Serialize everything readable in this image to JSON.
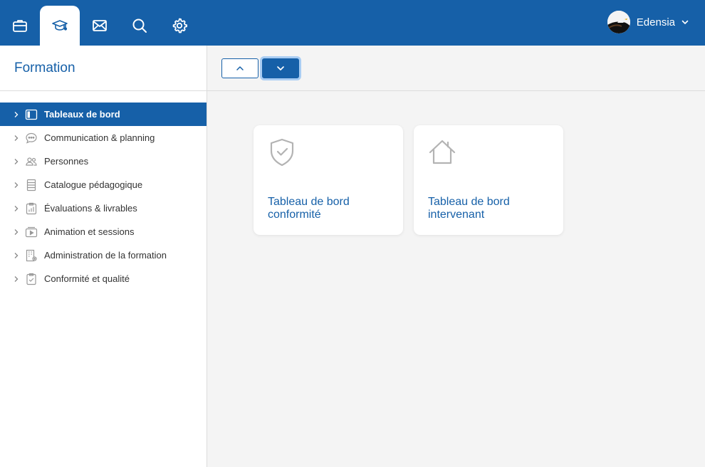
{
  "header": {
    "tabs": [
      {
        "icon": "briefcase-icon",
        "active": false
      },
      {
        "icon": "graduation-cap-icon",
        "active": true
      },
      {
        "icon": "mail-icon",
        "active": false
      },
      {
        "icon": "search-icon",
        "active": false
      },
      {
        "icon": "gear-icon",
        "active": false
      }
    ],
    "user": {
      "name": "Edensia",
      "avatar_icon": "eagle-avatar",
      "menu_icon": "chevron-down-icon"
    },
    "background_color": "#1660a8"
  },
  "sidebar": {
    "title": "Formation",
    "items": [
      {
        "label": "Tableaux de bord",
        "icon": "dashboard-icon",
        "active": true
      },
      {
        "label": "Communication & planning",
        "icon": "chat-bubble-icon",
        "active": false
      },
      {
        "label": "Personnes",
        "icon": "people-icon",
        "active": false
      },
      {
        "label": "Catalogue pédagogique",
        "icon": "list-icon",
        "active": false
      },
      {
        "label": "Évaluations & livrables",
        "icon": "chart-document-icon",
        "active": false
      },
      {
        "label": "Animation et sessions",
        "icon": "video-play-icon",
        "active": false
      },
      {
        "label": "Administration de la formation",
        "icon": "building-gear-icon",
        "active": false
      },
      {
        "label": "Conformité et qualité",
        "icon": "clipboard-check-icon",
        "active": false
      }
    ]
  },
  "toolbar": {
    "buttons": [
      {
        "icon": "chevron-up-icon",
        "style": "outline"
      },
      {
        "icon": "chevron-down-icon",
        "style": "filled-focused"
      }
    ]
  },
  "cards": [
    {
      "label": "Tableau de bord conformité",
      "icon": "shield-check-icon"
    },
    {
      "label": "Tableau de bord intervenant",
      "icon": "house-icon"
    }
  ],
  "colors": {
    "accent": "#1660a8",
    "focus_ring": "#a9cdf3",
    "background": "#f4f4f4",
    "card_icon": "#b3b3b3"
  }
}
